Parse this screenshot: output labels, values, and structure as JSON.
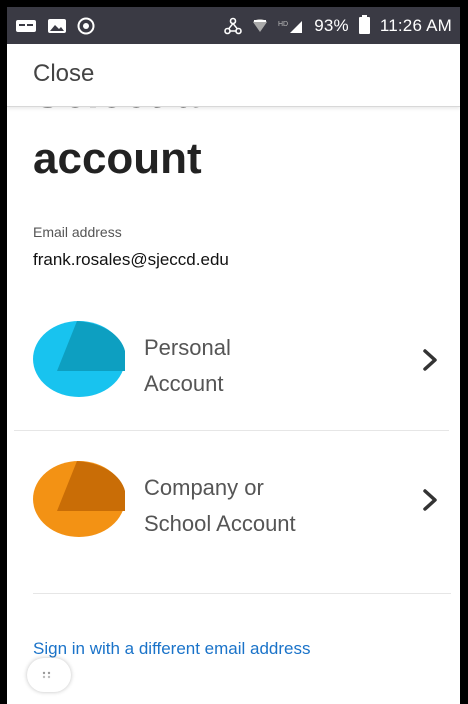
{
  "status_bar": {
    "battery_percent": "93%",
    "time": "11:26 AM",
    "signal_label": "HD",
    "left_icons": [
      "message-icon",
      "image-icon",
      "vpn-shield-icon"
    ],
    "right_icons": [
      "network-icon",
      "wifi-icon",
      "signal-icon",
      "battery-icon"
    ]
  },
  "topbar": {
    "close_label": "Close"
  },
  "main": {
    "heading_partial": "Select an",
    "heading": "account",
    "email_label": "Email address",
    "email_value": "frank.rosales@sjeccd.edu"
  },
  "accounts": [
    {
      "line1": "Personal",
      "line2": "Account",
      "color": "#18c3ef",
      "accent": "#0d9fc1"
    },
    {
      "line1": "Company or",
      "line2": "School Account",
      "color": "#f39214",
      "accent": "#c96d06"
    }
  ],
  "links": {
    "different_email": "Sign in with a different email address"
  }
}
